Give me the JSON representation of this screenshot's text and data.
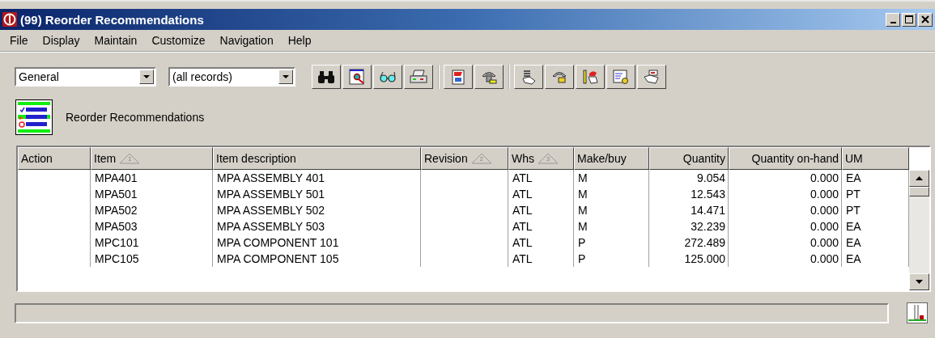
{
  "window": {
    "title": "(99) Reorder Recommendations"
  },
  "menu": [
    "File",
    "Display",
    "Maintain",
    "Customize",
    "Navigation",
    "Help"
  ],
  "toolbar": {
    "view": {
      "value": "General"
    },
    "filter": {
      "value": "(all records)"
    }
  },
  "heading": "Reorder Recommendations",
  "table": {
    "columns": [
      {
        "label": "Action"
      },
      {
        "label": "Item",
        "sort_order": "1"
      },
      {
        "label": "Item description"
      },
      {
        "label": "Revision",
        "sort_order": "2"
      },
      {
        "label": "Whs",
        "sort_order": "3"
      },
      {
        "label": "Make/buy"
      },
      {
        "label": "Quantity"
      },
      {
        "label": "Quantity on-hand"
      },
      {
        "label": "UM"
      }
    ],
    "rows": [
      [
        "",
        "MPA401",
        "MPA ASSEMBLY 401",
        "",
        "ATL",
        "M",
        "9.054",
        "0.000",
        "EA"
      ],
      [
        "",
        "MPA501",
        "MPA ASSEMBLY 501",
        "",
        "ATL",
        "M",
        "12.543",
        "0.000",
        "PT"
      ],
      [
        "",
        "MPA502",
        "MPA ASSEMBLY 502",
        "",
        "ATL",
        "M",
        "14.471",
        "0.000",
        "PT"
      ],
      [
        "",
        "MPA503",
        "MPA ASSEMBLY 503",
        "",
        "ATL",
        "M",
        "32.239",
        "0.000",
        "EA"
      ],
      [
        "",
        "MPC101",
        "MPA COMPONENT 101",
        "",
        "ATL",
        "P",
        "272.489",
        "0.000",
        "EA"
      ],
      [
        "",
        "MPC105",
        "MPA COMPONENT 105",
        "",
        "ATL",
        "P",
        "125.000",
        "0.000",
        "EA"
      ]
    ]
  }
}
